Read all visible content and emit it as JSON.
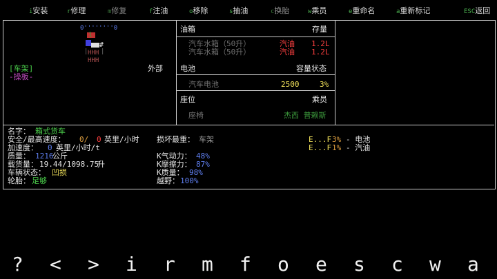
{
  "menu": [
    {
      "key": "i",
      "label": "安装",
      "dim": false,
      "key_color": "green"
    },
    {
      "key": "r",
      "label": "修理",
      "dim": false,
      "key_color": "green"
    },
    {
      "key": "m",
      "label": "修复",
      "dim": true,
      "key_color": "green"
    },
    {
      "key": "f",
      "label": "注油",
      "dim": false,
      "key_color": "green"
    },
    {
      "key": "o",
      "label": "移除",
      "dim": false,
      "key_color": "green"
    },
    {
      "key": "s",
      "label": "抽油",
      "dim": false,
      "key_color": "green"
    },
    {
      "key": "c",
      "label": "换胎",
      "dim": true,
      "key_color": "green"
    },
    {
      "key": "w",
      "label": "乘员",
      "dim": false,
      "key_color": "green"
    },
    {
      "key": "e",
      "label": "重命名",
      "dim": false,
      "key_color": "green"
    },
    {
      "key": "a",
      "label": "重新标记",
      "dim": false,
      "key_color": "green"
    },
    {
      "key": "ESC",
      "label": "返回",
      "dim": false,
      "key_color": "green"
    }
  ],
  "vehicle_map": {
    "top_marker": "0''''''''0",
    "row2": "1",
    "hash": "#",
    "hhh1": "HHH",
    "hhh2": "HHH",
    "side_left": "|",
    "side_right": "|"
  },
  "part_panel": {
    "selected_part": "[车架]",
    "sub_part": "-操板-",
    "location": "外部"
  },
  "tanks": {
    "header": "油箱",
    "header_right": "存量",
    "rows": [
      {
        "name": "汽车水箱（50升）",
        "fuel": "汽油",
        "amount": "1.2L"
      },
      {
        "name": "汽车水箱（50升）",
        "fuel": "汽油",
        "amount": "1.2L"
      }
    ]
  },
  "battery": {
    "header": "电池",
    "header_right": "容量状态",
    "rows": [
      {
        "name": "汽车电池",
        "capacity": "2500",
        "status": "3%"
      }
    ]
  },
  "seats": {
    "header": "座位",
    "header_right": "乘员",
    "rows": [
      {
        "name": "座椅",
        "occupant": "杰西 普赖斯"
      }
    ]
  },
  "stats": {
    "name_label": "名字：",
    "name_value": "箱式货车",
    "safe_speed_label": "安全/最高速度：",
    "safe_speed_value": "0/",
    "max_speed_value": "0",
    "speed_unit": "英里/小时",
    "accel_label": "加速度：",
    "accel_value": "0",
    "accel_unit": "英里/小时/t",
    "mass_label": "质量：",
    "mass_value": "1216",
    "mass_unit": "公斤",
    "cargo_label": "载货量：",
    "cargo_value": "19.44/1098.75",
    "cargo_unit": "升",
    "status_label": "车辆状态：",
    "status_value": "凹损",
    "wheels_label": "轮胎：",
    "wheels_value": "足够",
    "damage_label": "损坏最重：",
    "damage_value": "车架",
    "aero_label": "K气动力：",
    "aero_value": "48%",
    "friction_label": "K摩擦力：",
    "friction_value": "87%",
    "kmass_label": "K质量：",
    "kmass_value": "98%",
    "offroad_label": "越野：",
    "offroad_value": "100%",
    "gauge1_label": "E...F",
    "gauge1_value": "3%",
    "gauge1_name": "- 电池",
    "gauge2_label": "E...F",
    "gauge2_value": "1%",
    "gauge2_name": "- 汽油"
  },
  "bottom_keys": [
    "?",
    "<",
    ">",
    "i",
    "r",
    "m",
    "f",
    "o",
    "e",
    "s",
    "c",
    "w",
    "a"
  ]
}
